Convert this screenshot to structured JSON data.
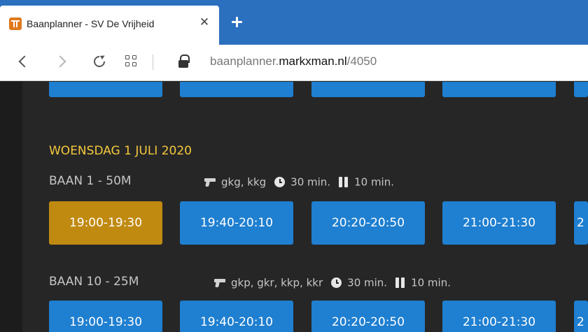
{
  "browser": {
    "tab_title": "Baanplanner - SV De Vrijheid",
    "close_glyph": "✕",
    "url_prefix": "baanplanner.",
    "url_host": "markxman.nl",
    "url_path": "/4050"
  },
  "day": {
    "title": "WOENSDAG 1 JULI 2020"
  },
  "lanes": [
    {
      "name": "BAAN 1 - 50M",
      "weapons": "gkg, kkg",
      "duration": "30 min.",
      "pause": "10 min.",
      "slots": [
        "19:00-19:30",
        "19:40-20:10",
        "20:20-20:50",
        "21:00-21:30",
        "2"
      ],
      "selected_index": 0
    },
    {
      "name": "BAAN 10 - 25M",
      "weapons": "gkp, gkr, kkp, kkr",
      "duration": "30 min.",
      "pause": "10 min.",
      "slots": [
        "19:00-19:30",
        "19:40-20:10",
        "20:20-20:50",
        "21:00-21:30",
        "2"
      ],
      "selected_index": -1
    }
  ],
  "colors": {
    "tabstrip": "#2b6fbf",
    "slot": "#1f7fd0",
    "slot_selected": "#c08a11",
    "day_title": "#f4c83e",
    "page_bg": "#262626"
  }
}
